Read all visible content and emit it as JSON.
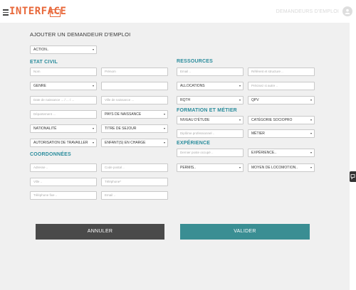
{
  "header": {
    "logo_main": "INTER",
    "logo_rest": "FACE",
    "logo_badge": "ROMA 3",
    "title": "DEMANDEURS D'EMPLOI",
    "avatar_icon": "user-icon"
  },
  "page": {
    "title": "AJOUTER UN DEMANDEUR D'EMPLOI",
    "action_select": "ACTION.."
  },
  "sections": {
    "etat_civil": "ETAT CIVIL",
    "coordonnees": "COORDONNÉES",
    "ressources": "RESSOURCES",
    "formation": "FORMATION ET MÉTIER",
    "experience": "EXPÉRIENCE"
  },
  "etat_civil": {
    "nom": "Nom",
    "prenom": "Prénom",
    "genre": "GENRE",
    "date_naissance": "Date de naissance ... / ... / ...",
    "ville_naissance": "Ville de naissance ...",
    "departement": "Département ...",
    "pays_naissance": "PAYS DE NAISSANCE",
    "nationalite": "NATIONALITÉ",
    "titre_sejour": "TITRE DE SEJOUR",
    "autorisation": "AUTORISATION DE TRAVAILLER",
    "enfants": "ENFANT(S) EN CHARGE"
  },
  "coordonnees": {
    "adresse": "Adresse ..",
    "code_postal": "Code postal ..",
    "ville": "Ville ..",
    "telephone": "Téléphone*",
    "telephone_fixe": "Téléphone fixe ..",
    "email": "Email .."
  },
  "ressources": {
    "email": "Email ..",
    "referent": "Référent et structure ..",
    "allocations": "ALLOCATIONS",
    "precisez": "Précisez si autre ..",
    "rqth": "RQTH",
    "qpv": "QPV"
  },
  "formation": {
    "niveau_etude": "NIVEAU D'ÉTUDE",
    "categorie": "CATÉGORIE SOCIOPRO",
    "diplome": "Diplôme professionnel ..",
    "metier": "MÉTIER"
  },
  "experience": {
    "dernier_poste": "Dernier poste occupé ..",
    "experience_select": "EXPÉRIENCE..",
    "permis": "PERMIS..",
    "locomotion": "MOYEN DE LOCOMOTION.."
  },
  "buttons": {
    "cancel": "ANNULER",
    "validate": "VALIDER"
  }
}
